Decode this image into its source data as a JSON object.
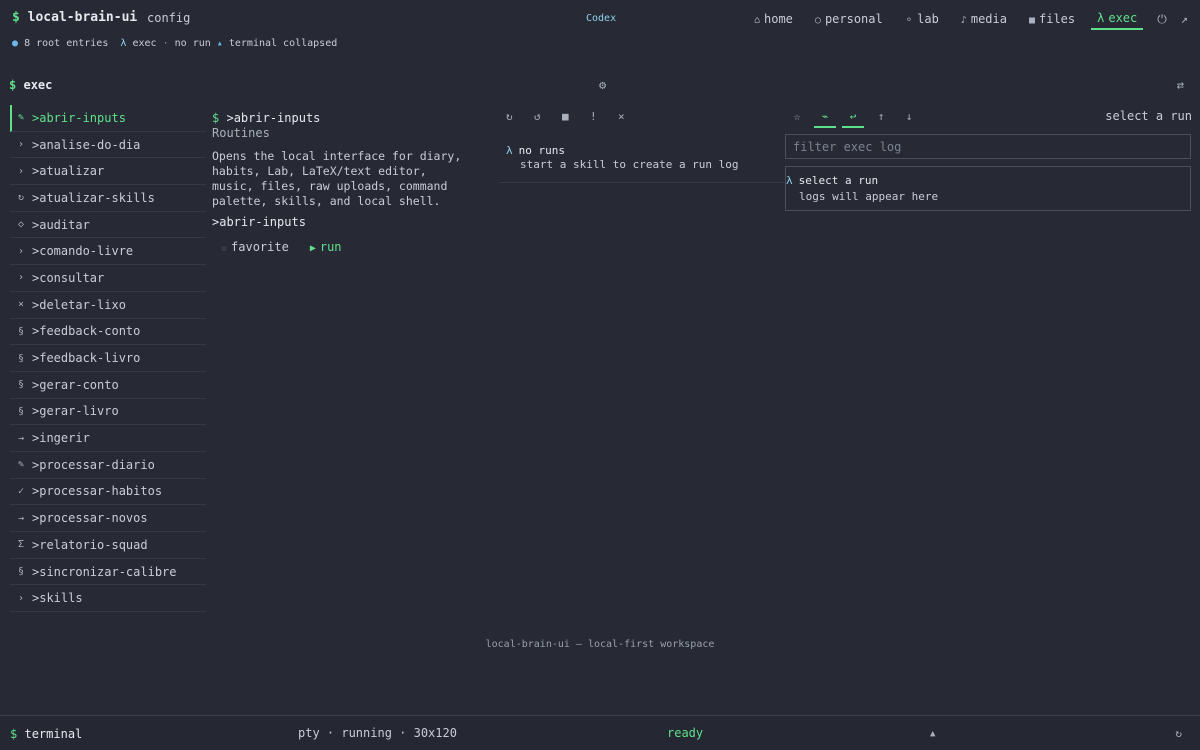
{
  "app": {
    "brand_prefix": "$",
    "brand": "local-brain-ui",
    "config_label": "config",
    "engine_tag": "Codex"
  },
  "nav": {
    "items": [
      {
        "icon": "⌂",
        "label": "home"
      },
      {
        "icon": "○",
        "label": "personal"
      },
      {
        "icon": "⚬",
        "label": "lab"
      },
      {
        "icon": "♪",
        "label": "media"
      },
      {
        "icon": "■",
        "label": "files"
      },
      {
        "icon": "λ",
        "label": "exec",
        "active": true
      }
    ],
    "power_icon": "⏻",
    "popout_icon": "↗"
  },
  "statusline": {
    "dot": "●",
    "entries": "8 root entries",
    "exec_prefix": "λ",
    "exec": "exec",
    "sep": "·",
    "run_state": "no run",
    "terminal_icon": "▴",
    "terminal_state": "terminal collapsed"
  },
  "section": {
    "prefix": "$",
    "title": "exec",
    "gear_icon": "⚙",
    "swap_icon": "⇄"
  },
  "sidebar": {
    "items": [
      {
        "icon": "✎",
        "label": ">abrir-inputs",
        "active": true
      },
      {
        "icon": "›",
        "label": ">analise-do-dia"
      },
      {
        "icon": "›",
        "label": ">atualizar"
      },
      {
        "icon": "↻",
        "label": ">atualizar-skills"
      },
      {
        "icon": "◇",
        "label": ">auditar"
      },
      {
        "icon": "›",
        "label": ">comando-livre"
      },
      {
        "icon": "›",
        "label": ">consultar"
      },
      {
        "icon": "×",
        "label": ">deletar-lixo"
      },
      {
        "icon": "§",
        "label": ">feedback-conto"
      },
      {
        "icon": "§",
        "label": ">feedback-livro"
      },
      {
        "icon": "§",
        "label": ">gerar-conto"
      },
      {
        "icon": "§",
        "label": ">gerar-livro"
      },
      {
        "icon": "→",
        "label": ">ingerir"
      },
      {
        "icon": "✎",
        "label": ">processar-diario"
      },
      {
        "icon": "✓",
        "label": ">processar-habitos"
      },
      {
        "icon": "→",
        "label": ">processar-novos"
      },
      {
        "icon": "Σ",
        "label": ">relatorio-squad"
      },
      {
        "icon": "§",
        "label": ">sincronizar-calibre"
      },
      {
        "icon": "›",
        "label": ">skills"
      }
    ]
  },
  "detail": {
    "prefix": "$",
    "title": ">abrir-inputs",
    "category": "Routines",
    "description": "Opens the local interface for diary, habits, Lab, LaTeX/text editor, music, files, raw uploads, command palette, skills, and local shell.",
    "command": ">abrir-inputs",
    "favorite_icon": "☆",
    "favorite_label": "favorite",
    "run_icon": "▶",
    "run_label": "run"
  },
  "runs": {
    "toolbar": [
      "↻",
      "↺",
      "■",
      "!",
      "×"
    ],
    "empty_prefix": "λ",
    "empty_title": "no runs",
    "empty_sub": "start a skill to create a run log"
  },
  "log": {
    "star_icon": "☆",
    "wrap_icon": "⌁",
    "return_icon": "↩",
    "up_icon": "↑",
    "down_icon": "↓",
    "status": "select a run",
    "filter_placeholder": "filter exec log",
    "box_prefix": "λ",
    "box_title": "select a run",
    "box_sub": "logs will appear here"
  },
  "footnote": "local-brain-ui — local-first workspace",
  "terminal": {
    "prefix": "$",
    "title": "terminal",
    "info": "pty · running · 30x120",
    "state": "ready",
    "expand_icon": "▲",
    "reload_icon": "↻"
  },
  "colors": {
    "background": "#272a35",
    "accent": "#5fe08a",
    "info": "#8fd3e8",
    "border": "#4a4f5e"
  }
}
